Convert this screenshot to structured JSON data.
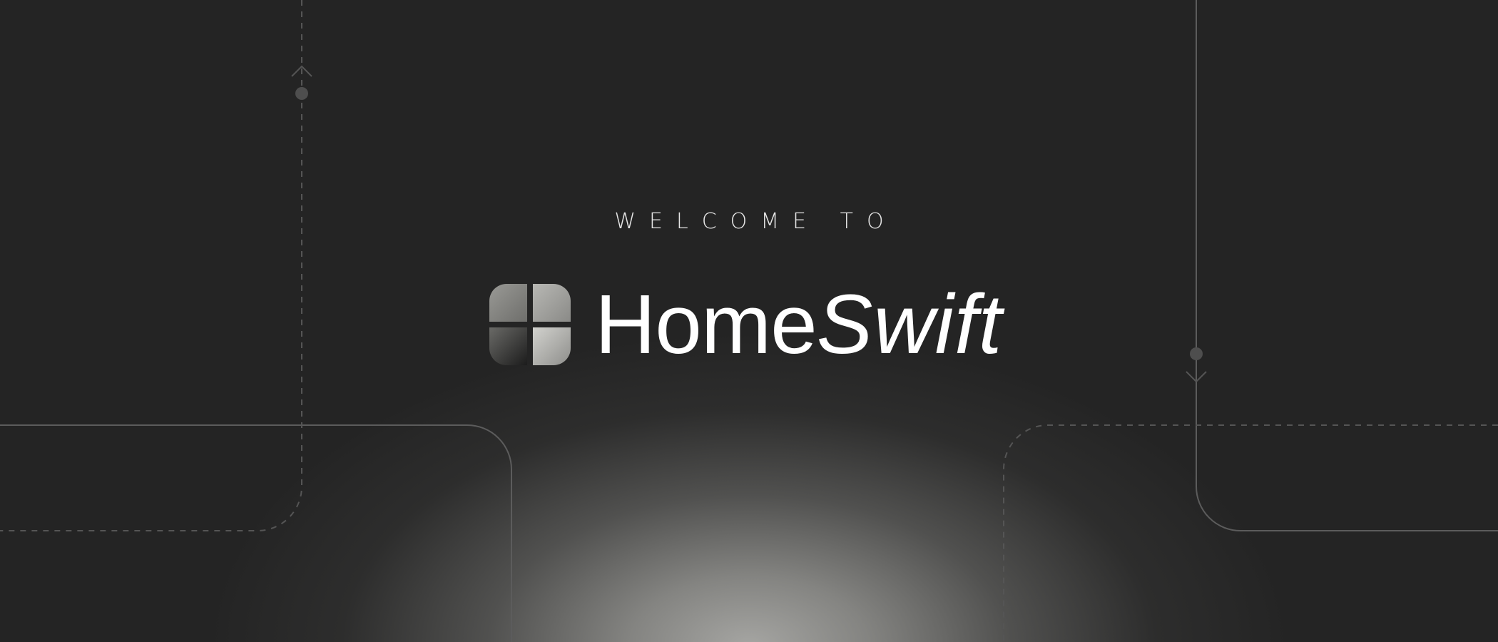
{
  "hero": {
    "eyebrow": "WELCOME TO",
    "brand_primary": "Home",
    "brand_secondary": "Swift"
  },
  "logo": {
    "icon": "window-grid-icon"
  },
  "decorations": {
    "arrow_up_icon": "arrow-up-icon",
    "arrow_down_icon": "arrow-down-icon"
  },
  "colors": {
    "background": "#242424",
    "glow": "#a5a5a2",
    "text": "#ffffff",
    "line": "#5a5a5a"
  }
}
